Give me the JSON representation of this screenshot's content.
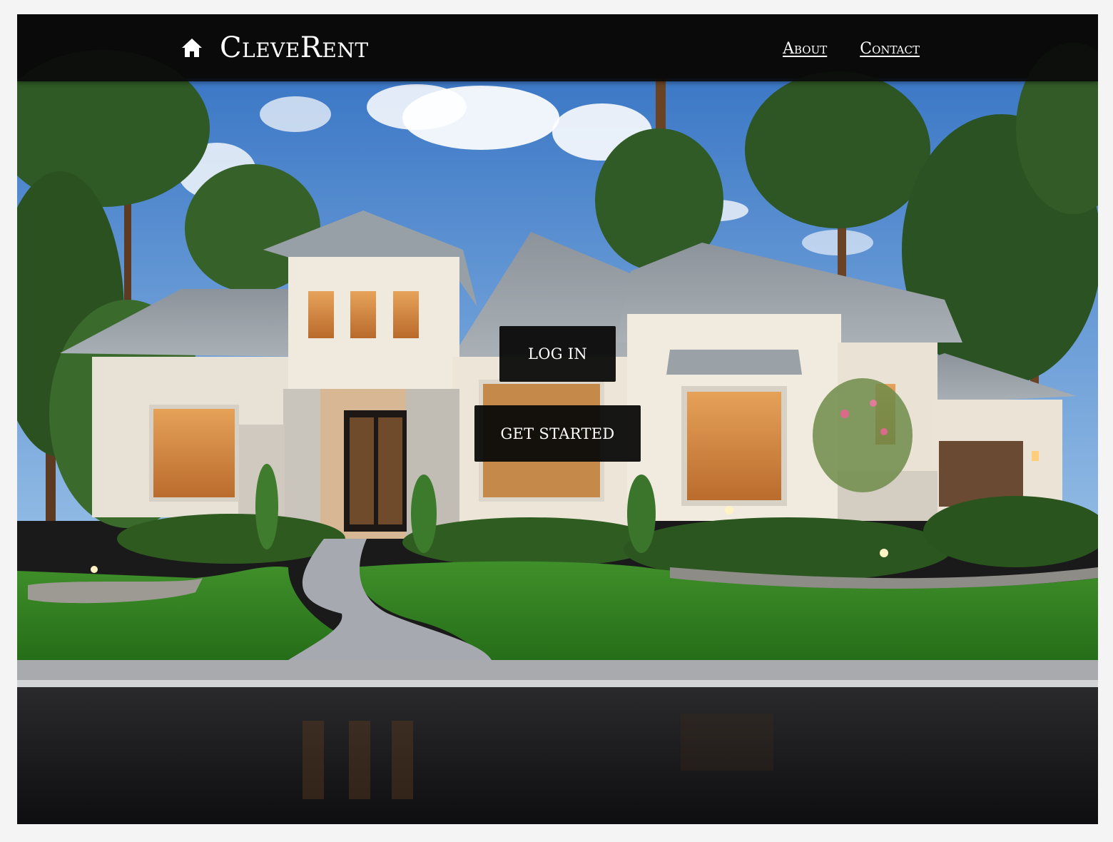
{
  "page": {
    "hero_image": "modern-house-exterior"
  },
  "navbar": {
    "brand": "CleveRent",
    "brand_icon": "home-icon",
    "links": [
      {
        "label": "About"
      },
      {
        "label": "Contact"
      }
    ]
  },
  "hero": {
    "login_label": "LOG IN",
    "get_started_label": "GET STARTED"
  },
  "colors": {
    "navbar_bg": "#0a0a0a",
    "button_bg": "#080808",
    "text": "#ffffff"
  }
}
